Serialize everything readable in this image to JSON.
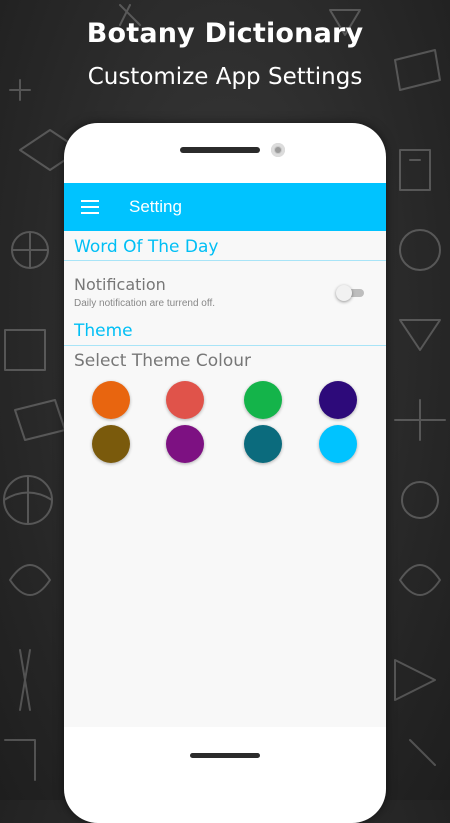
{
  "promo": {
    "title": "Botany Dictionary",
    "subtitle": "Customize App Settings"
  },
  "app_bar": {
    "title": "Setting",
    "menu_icon": "hamburger-menu-icon",
    "background_color": "#00c3ff"
  },
  "sections": {
    "word_of_the_day": {
      "header": "Word Of The Day",
      "notification": {
        "title": "Notification",
        "summary": "Daily notification are turrend off.",
        "enabled": false
      }
    },
    "theme": {
      "header": "Theme",
      "select_label": "Select Theme Colour",
      "colours": [
        "#e8650f",
        "#e0534a",
        "#14b44a",
        "#2d0a7a",
        "#7a5a0c",
        "#7d1182",
        "#0b6b7d",
        "#00c3ff"
      ]
    }
  },
  "accent_color": "#00bff5"
}
